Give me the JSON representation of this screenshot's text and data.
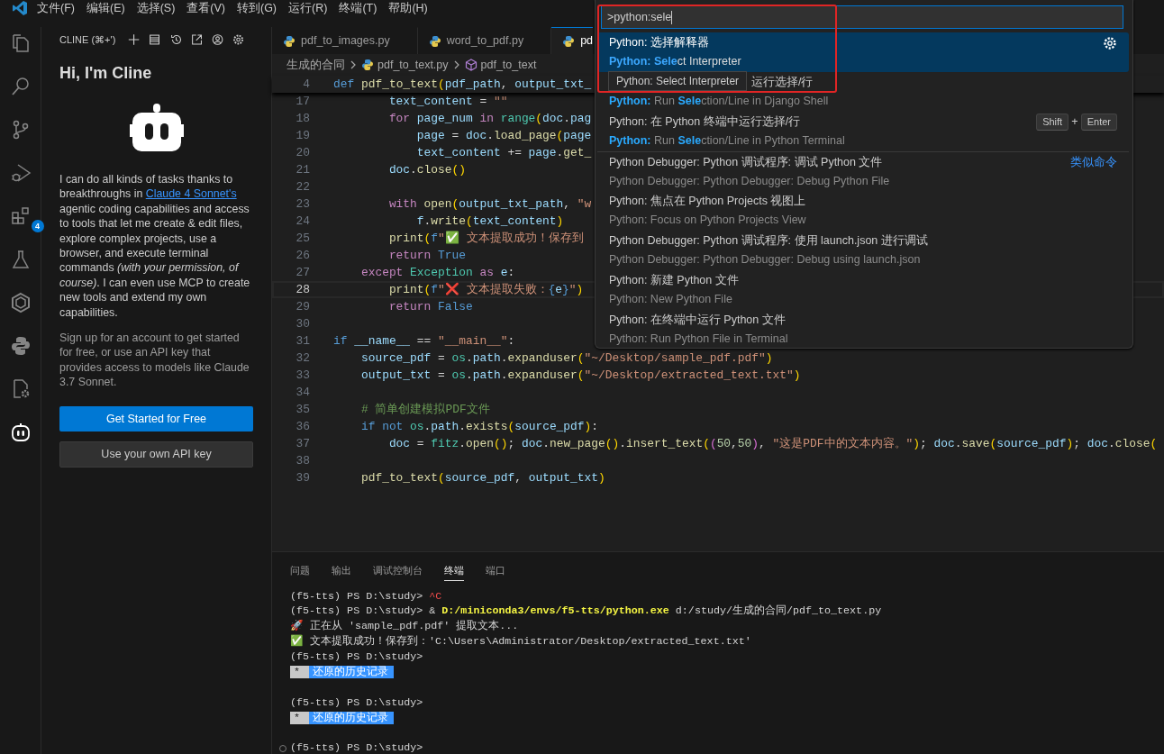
{
  "menu": [
    "文件(F)",
    "编辑(E)",
    "选择(S)",
    "查看(V)",
    "转到(G)",
    "运行(R)",
    "终端(T)",
    "帮助(H)"
  ],
  "activity_bar": [
    {
      "kind": "files",
      "selected": false
    },
    {
      "kind": "search",
      "selected": false
    },
    {
      "kind": "branch",
      "selected": false
    },
    {
      "kind": "debug",
      "selected": false
    },
    {
      "kind": "extensions",
      "selected": false,
      "badge": "4"
    },
    {
      "kind": "flask",
      "selected": false
    },
    {
      "kind": "hexring",
      "selected": false
    },
    {
      "kind": "python",
      "selected": false
    },
    {
      "kind": "cppgear",
      "selected": false
    },
    {
      "kind": "robot",
      "selected": true
    }
  ],
  "sidebar": {
    "title": "CLINE (⌘+')",
    "heading": "Hi, I'm Cline",
    "intro": {
      "before": "I can do all kinds of tasks thanks to breakthroughs in",
      "link": "Claude 4 Sonnet's",
      "after": "agentic coding capabilities and access to tools that let me create & edit files, explore complex projects, use a browser, and execute terminal commands *(with your permission, of course)*. I can even use MCP to create new tools and extend my own capabilities."
    },
    "note": "Sign up for an account to get started for free, or use an API key that provides access to models like Claude 3.7 Sonnet.",
    "buttons": [
      {
        "label": "Get Started for Free",
        "kind": "primary"
      },
      {
        "label": "Use your own API key",
        "kind": "secondary"
      }
    ]
  },
  "tabs": [
    {
      "label": "pdf_to_images.py",
      "selected": false
    },
    {
      "label": "word_to_pdf.py",
      "selected": false
    },
    {
      "label": "pd",
      "selected": true
    }
  ],
  "breadcrumbs": [
    {
      "kind": "folder",
      "text": "生成的合同"
    },
    {
      "kind": "file",
      "text": "pdf_to_text.py"
    },
    {
      "kind": "symbol",
      "text": "pdf_to_text"
    }
  ],
  "sticky_line": {
    "n": "4",
    "tokens": [
      {
        "kind": "kw",
        "text": "def "
      },
      {
        "kind": "fn",
        "text": "pdf_to_text"
      },
      {
        "kind": "b1",
        "text": "("
      },
      {
        "kind": "var",
        "text": "pdf_path"
      },
      {
        "kind": "p",
        "text": ", "
      },
      {
        "kind": "var",
        "text": "output_txt_"
      }
    ]
  },
  "lines": [
    {
      "n": "17",
      "current": false,
      "tokens": [
        {
          "kind": "var",
          "text": "        text_content"
        },
        {
          "kind": "p",
          "text": " = "
        },
        {
          "kind": "str",
          "text": "\"\""
        }
      ]
    },
    {
      "n": "18",
      "current": false,
      "tokens": [
        {
          "kind": "ctl",
          "text": "        for "
        },
        {
          "kind": "var",
          "text": "page_num "
        },
        {
          "kind": "ctl",
          "text": "in "
        },
        {
          "kind": "cls",
          "text": "range"
        },
        {
          "kind": "b1",
          "text": "("
        },
        {
          "kind": "var",
          "text": "doc"
        },
        {
          "kind": "p",
          "text": "."
        },
        {
          "kind": "var",
          "text": "pag"
        }
      ]
    },
    {
      "n": "19",
      "current": false,
      "tokens": [
        {
          "kind": "var",
          "text": "            page"
        },
        {
          "kind": "p",
          "text": " = "
        },
        {
          "kind": "var",
          "text": "doc"
        },
        {
          "kind": "p",
          "text": "."
        },
        {
          "kind": "fn",
          "text": "load_page"
        },
        {
          "kind": "b1",
          "text": "("
        },
        {
          "kind": "var",
          "text": "page"
        }
      ]
    },
    {
      "n": "20",
      "current": false,
      "tokens": [
        {
          "kind": "var",
          "text": "            text_content"
        },
        {
          "kind": "p",
          "text": " += "
        },
        {
          "kind": "var",
          "text": "page"
        },
        {
          "kind": "p",
          "text": "."
        },
        {
          "kind": "fn",
          "text": "get_"
        }
      ]
    },
    {
      "n": "21",
      "current": false,
      "tokens": [
        {
          "kind": "var",
          "text": "        doc"
        },
        {
          "kind": "p",
          "text": "."
        },
        {
          "kind": "fn",
          "text": "close"
        },
        {
          "kind": "b1",
          "text": "()"
        }
      ]
    },
    {
      "n": "22",
      "current": false
    },
    {
      "n": "23",
      "current": false,
      "tokens": [
        {
          "kind": "ctl",
          "text": "        with "
        },
        {
          "kind": "fn",
          "text": "open"
        },
        {
          "kind": "b1",
          "text": "("
        },
        {
          "kind": "var",
          "text": "output_txt_path"
        },
        {
          "kind": "p",
          "text": ", "
        },
        {
          "kind": "str",
          "text": "\"w"
        }
      ]
    },
    {
      "n": "24",
      "current": false,
      "tokens": [
        {
          "kind": "var",
          "text": "            f"
        },
        {
          "kind": "p",
          "text": "."
        },
        {
          "kind": "fn",
          "text": "write"
        },
        {
          "kind": "b1",
          "text": "("
        },
        {
          "kind": "var",
          "text": "text_content"
        },
        {
          "kind": "b1",
          "text": ")"
        }
      ]
    },
    {
      "n": "25",
      "current": false,
      "tokens": [
        {
          "kind": "fn",
          "text": "        print"
        },
        {
          "kind": "b1",
          "text": "("
        },
        {
          "kind": "kw",
          "text": "f"
        },
        {
          "kind": "str",
          "text": "\"✅ 文本提取成功！保存到"
        }
      ]
    },
    {
      "n": "26",
      "current": false,
      "tokens": [
        {
          "kind": "ctl",
          "text": "        return "
        },
        {
          "kind": "kw",
          "text": "True"
        }
      ]
    },
    {
      "n": "27",
      "current": false,
      "tokens": [
        {
          "kind": "ctl",
          "text": "    except "
        },
        {
          "kind": "cls",
          "text": "Exception "
        },
        {
          "kind": "ctl",
          "text": "as "
        },
        {
          "kind": "var",
          "text": "e"
        },
        {
          "kind": "p",
          "text": ":"
        }
      ]
    },
    {
      "n": "28",
      "current": true,
      "tokens": [
        {
          "kind": "fn",
          "text": "        print"
        },
        {
          "kind": "b1",
          "text": "("
        },
        {
          "kind": "kw",
          "text": "f"
        },
        {
          "kind": "str",
          "text": "\"❌ 文本提取失败："
        },
        {
          "kind": "kw",
          "text": "{"
        },
        {
          "kind": "var",
          "text": "e"
        },
        {
          "kind": "kw",
          "text": "}"
        },
        {
          "kind": "str",
          "text": "\""
        },
        {
          "kind": "b1",
          "text": ")"
        }
      ]
    },
    {
      "n": "29",
      "current": false,
      "tokens": [
        {
          "kind": "ctl",
          "text": "        return "
        },
        {
          "kind": "kw",
          "text": "False"
        }
      ]
    },
    {
      "n": "30",
      "current": false
    },
    {
      "n": "31",
      "current": false,
      "tokens": [
        {
          "kind": "kw",
          "text": "if "
        },
        {
          "kind": "var",
          "text": "__name__"
        },
        {
          "kind": "p",
          "text": " == "
        },
        {
          "kind": "str",
          "text": "\"__main__\""
        },
        {
          "kind": "p",
          "text": ":"
        }
      ]
    },
    {
      "n": "32",
      "current": false,
      "tokens": [
        {
          "kind": "var",
          "text": "    source_pdf"
        },
        {
          "kind": "p",
          "text": " = "
        },
        {
          "kind": "cls",
          "text": "os"
        },
        {
          "kind": "p",
          "text": "."
        },
        {
          "kind": "var",
          "text": "path"
        },
        {
          "kind": "p",
          "text": "."
        },
        {
          "kind": "fn",
          "text": "expanduser"
        },
        {
          "kind": "b1",
          "text": "("
        },
        {
          "kind": "str",
          "text": "\"~/Desktop/sample_pdf.pdf\""
        },
        {
          "kind": "b1",
          "text": ")"
        }
      ]
    },
    {
      "n": "33",
      "current": false,
      "tokens": [
        {
          "kind": "var",
          "text": "    output_txt"
        },
        {
          "kind": "p",
          "text": " = "
        },
        {
          "kind": "cls",
          "text": "os"
        },
        {
          "kind": "p",
          "text": "."
        },
        {
          "kind": "var",
          "text": "path"
        },
        {
          "kind": "p",
          "text": "."
        },
        {
          "kind": "fn",
          "text": "expanduser"
        },
        {
          "kind": "b1",
          "text": "("
        },
        {
          "kind": "str",
          "text": "\"~/Desktop/extracted_text.txt\""
        },
        {
          "kind": "b1",
          "text": ")"
        }
      ]
    },
    {
      "n": "34",
      "current": false
    },
    {
      "n": "35",
      "current": false,
      "tokens": [
        {
          "kind": "cmt",
          "text": "    # 简单创建模拟PDF文件"
        }
      ]
    },
    {
      "n": "36",
      "current": false,
      "tokens": [
        {
          "kind": "kw",
          "text": "    if not "
        },
        {
          "kind": "cls",
          "text": "os"
        },
        {
          "kind": "p",
          "text": "."
        },
        {
          "kind": "var",
          "text": "path"
        },
        {
          "kind": "p",
          "text": "."
        },
        {
          "kind": "fn",
          "text": "exists"
        },
        {
          "kind": "b1",
          "text": "("
        },
        {
          "kind": "var",
          "text": "source_pdf"
        },
        {
          "kind": "b1",
          "text": ")"
        },
        {
          "kind": "p",
          "text": ":"
        }
      ]
    },
    {
      "n": "37",
      "current": false,
      "tokens": [
        {
          "kind": "var",
          "text": "        doc"
        },
        {
          "kind": "p",
          "text": " = "
        },
        {
          "kind": "cls",
          "text": "fitz"
        },
        {
          "kind": "p",
          "text": "."
        },
        {
          "kind": "fn",
          "text": "open"
        },
        {
          "kind": "b1",
          "text": "()"
        },
        {
          "kind": "p",
          "text": "; "
        },
        {
          "kind": "var",
          "text": "doc"
        },
        {
          "kind": "p",
          "text": "."
        },
        {
          "kind": "fn",
          "text": "new_page"
        },
        {
          "kind": "b1",
          "text": "()"
        },
        {
          "kind": "p",
          "text": "."
        },
        {
          "kind": "fn",
          "text": "insert_text"
        },
        {
          "kind": "b1",
          "text": "("
        },
        {
          "kind": "b2",
          "text": "("
        },
        {
          "kind": "num",
          "text": "50"
        },
        {
          "kind": "p",
          "text": ","
        },
        {
          "kind": "num",
          "text": "50"
        },
        {
          "kind": "b2",
          "text": ")"
        },
        {
          "kind": "p",
          "text": ", "
        },
        {
          "kind": "str",
          "text": "\"这是PDF中的文本内容。\""
        },
        {
          "kind": "b1",
          "text": ")"
        },
        {
          "kind": "p",
          "text": "; "
        },
        {
          "kind": "var",
          "text": "doc"
        },
        {
          "kind": "p",
          "text": "."
        },
        {
          "kind": "fn",
          "text": "save"
        },
        {
          "kind": "b1",
          "text": "("
        },
        {
          "kind": "var",
          "text": "source_pdf"
        },
        {
          "kind": "b1",
          "text": ")"
        },
        {
          "kind": "p",
          "text": "; "
        },
        {
          "kind": "var",
          "text": "doc"
        },
        {
          "kind": "p",
          "text": "."
        },
        {
          "kind": "fn",
          "text": "close"
        },
        {
          "kind": "b1",
          "text": "("
        }
      ]
    },
    {
      "n": "38",
      "current": false
    },
    {
      "n": "39",
      "current": false,
      "tokens": [
        {
          "kind": "fn",
          "text": "    pdf_to_text"
        },
        {
          "kind": "b1",
          "text": "("
        },
        {
          "kind": "var",
          "text": "source_pdf"
        },
        {
          "kind": "p",
          "text": ", "
        },
        {
          "kind": "var",
          "text": "output_txt"
        },
        {
          "kind": "b1",
          "text": ")"
        }
      ]
    }
  ],
  "palette": {
    "input": ">python:sele",
    "tooltip": "Python: Select Interpreter",
    "annotation": {
      "kind": "rectangle"
    },
    "items": [
      {
        "label": "Python: 选择解释器",
        "detail": "**Python: Sele**ct Interpreter",
        "selected": true,
        "covered": false,
        "gear": true
      },
      {
        "label": "运行选择/行",
        "detail": "**Python:** Run **Sele**ction/Line in Django Shell",
        "selected": false,
        "covered": true
      },
      {
        "label": "Python: 在 Python 终端中运行选择/行",
        "detail": "**Python:** Run **Sele**ction/Line in Python Terminal",
        "selected": false,
        "covered": false,
        "keys": [
          "Shift",
          "Enter"
        ],
        "joiner": "+"
      },
      {
        "label": "Python Debugger: Python 调试程序: 调试 Python 文件",
        "detail": "Python Debugger: Python Debugger: Debug Python File",
        "selected": false,
        "covered": false,
        "group": "类似命令"
      },
      {
        "label": "Python: 焦点在 Python Projects 视图上",
        "detail": "Python: Focus on Python Projects View",
        "selected": false,
        "covered": false
      },
      {
        "label": "Python Debugger: Python 调试程序: 使用 launch.json 进行调试",
        "detail": "Python Debugger: Python Debugger: Debug using launch.json",
        "selected": false,
        "covered": false
      },
      {
        "label": "Python: 新建 Python 文件",
        "detail": "Python: New Python File",
        "selected": false,
        "covered": false
      },
      {
        "label": "Python: 在终端中运行 Python 文件",
        "detail": "Python: Run Python File in Terminal",
        "selected": false,
        "covered": false
      }
    ]
  },
  "panel_tabs": [
    {
      "label": "问题",
      "selected": false
    },
    {
      "label": "输出",
      "selected": false
    },
    {
      "label": "调试控制台",
      "selected": false
    },
    {
      "label": "终端",
      "selected": true
    },
    {
      "label": "端口",
      "selected": false
    }
  ],
  "terminal": [
    {
      "kind": "output",
      "tokens": [
        {
          "kind": "p",
          "text": "(f5-tts) PS D:\\study> "
        },
        {
          "kind": "red",
          "text": "^C"
        }
      ]
    },
    {
      "kind": "output",
      "tokens": [
        {
          "kind": "p",
          "text": "(f5-tts) PS D:\\study> & "
        },
        {
          "kind": "yel",
          "text": "D:/miniconda3/envs/f5-tts/python.exe"
        },
        {
          "kind": "p",
          "text": " d:/study/生成的合同/pdf_to_text.py"
        }
      ]
    },
    {
      "kind": "output",
      "tokens": [
        {
          "kind": "p",
          "text": "🚀 正在从 'sample_pdf.pdf' 提取文本..."
        }
      ]
    },
    {
      "kind": "output",
      "tokens": [
        {
          "kind": "p",
          "text": "✅ 文本提取成功！保存到：'C:\\Users\\Administrator/Desktop/extracted_text.txt'"
        }
      ]
    },
    {
      "kind": "output",
      "tokens": [
        {
          "kind": "p",
          "text": "(f5-tts) PS D:\\study>"
        }
      ]
    },
    {
      "kind": "history",
      "marker": "*",
      "text": "还原的历史记录"
    },
    {
      "kind": "blank"
    },
    {
      "kind": "output",
      "tokens": [
        {
          "kind": "p",
          "text": "(f5-tts) PS D:\\study>"
        }
      ]
    },
    {
      "kind": "history",
      "marker": "*",
      "text": "还原的历史记录"
    },
    {
      "kind": "blank"
    },
    {
      "kind": "output",
      "decoration": true,
      "tokens": [
        {
          "kind": "p",
          "text": "(f5-tts) PS D:\\study>"
        }
      ]
    }
  ]
}
